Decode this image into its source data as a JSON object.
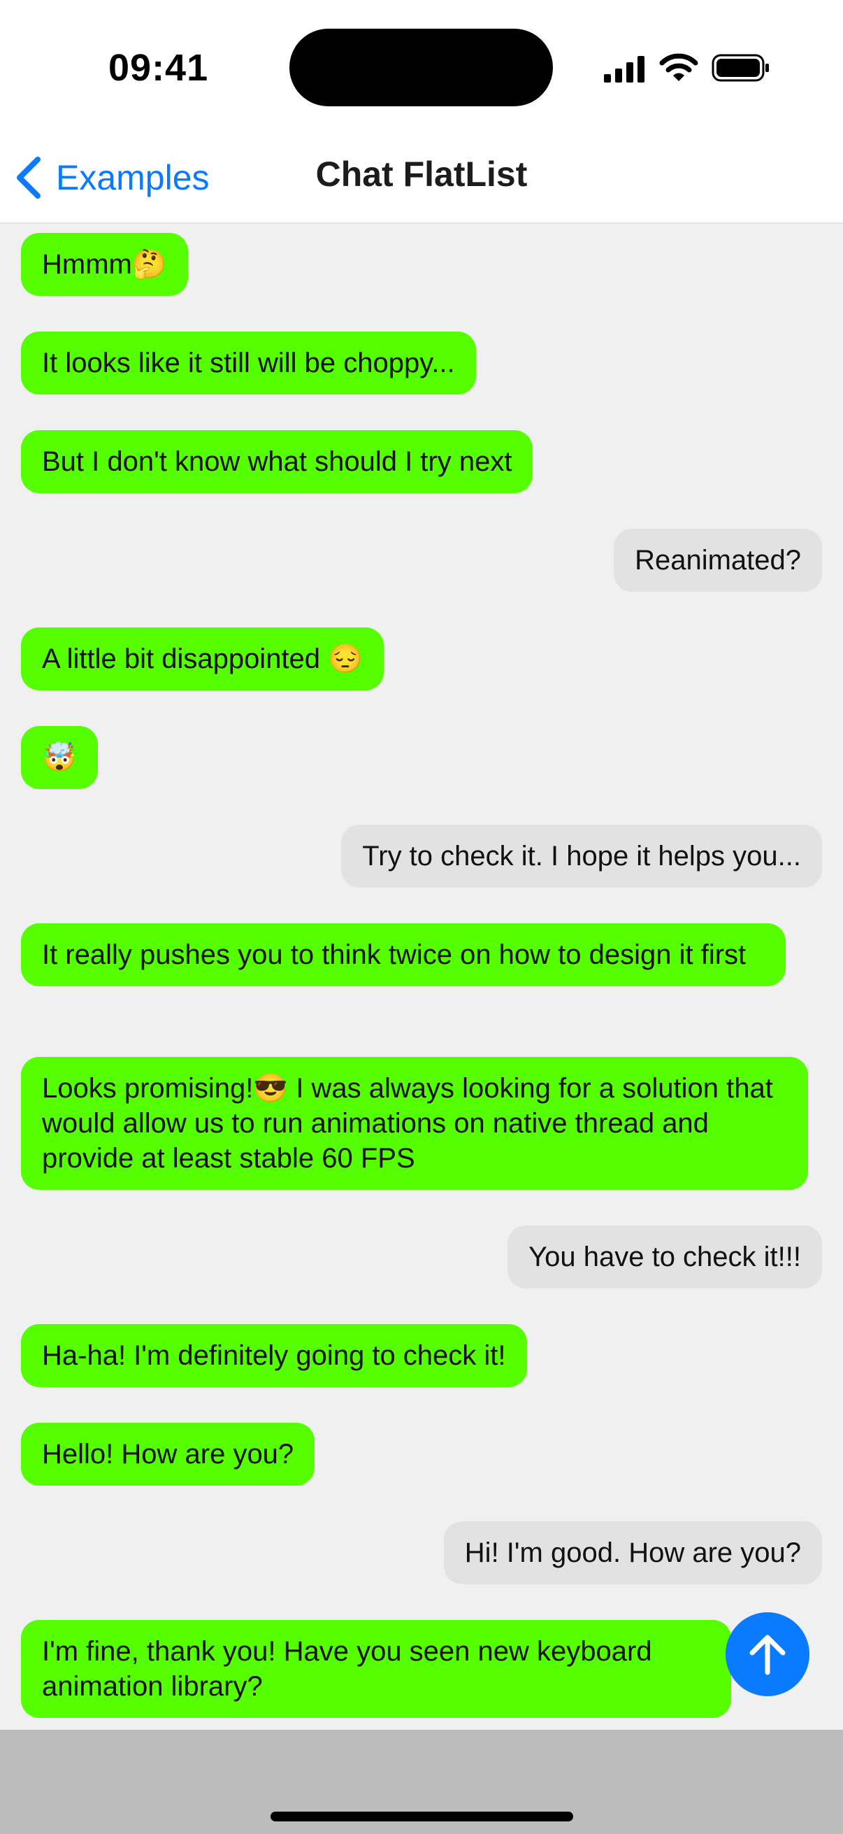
{
  "status_bar": {
    "time": "09:41",
    "icons": [
      "signal-icon",
      "wifi-icon",
      "battery-icon"
    ]
  },
  "nav": {
    "back_label": "Examples",
    "title": "Chat FlatList",
    "back_icon": "chevron-left-icon"
  },
  "messages": [
    {
      "text": "Hmmm🤔",
      "sender": "other"
    },
    {
      "text": "It looks like it still will be choppy...",
      "sender": "other"
    },
    {
      "text": "But I don't know what should I try next",
      "sender": "other"
    },
    {
      "text": "Reanimated?",
      "sender": "me"
    },
    {
      "text": "A little bit disappointed 😔",
      "sender": "other"
    },
    {
      "text": "🤯",
      "sender": "other"
    },
    {
      "text": "Try to check it. I hope it helps you...",
      "sender": "me"
    },
    {
      "text": "It really pushes you to think twice on how to design it first",
      "sender": "other"
    },
    {
      "text": "Looks promising!😎 I was always looking for a solution that would allow us to run animations on native thread and provide at least stable 60 FPS",
      "sender": "other"
    },
    {
      "text": "You have to check it!!!",
      "sender": "me"
    },
    {
      "text": "Ha-ha! I'm definitely going to check it!",
      "sender": "other"
    },
    {
      "text": "Hello! How are you?",
      "sender": "other"
    },
    {
      "text": "Hi! I'm good. How are you?",
      "sender": "me"
    },
    {
      "text": "I'm fine, thank you! Have you seen new keyboard animation library?",
      "sender": "other"
    }
  ],
  "fab_icon": "arrow-up-icon",
  "colors": {
    "incoming_bubble": "#55ff00",
    "outgoing_bubble": "#e2e2e2",
    "accent": "#0a7aff"
  }
}
